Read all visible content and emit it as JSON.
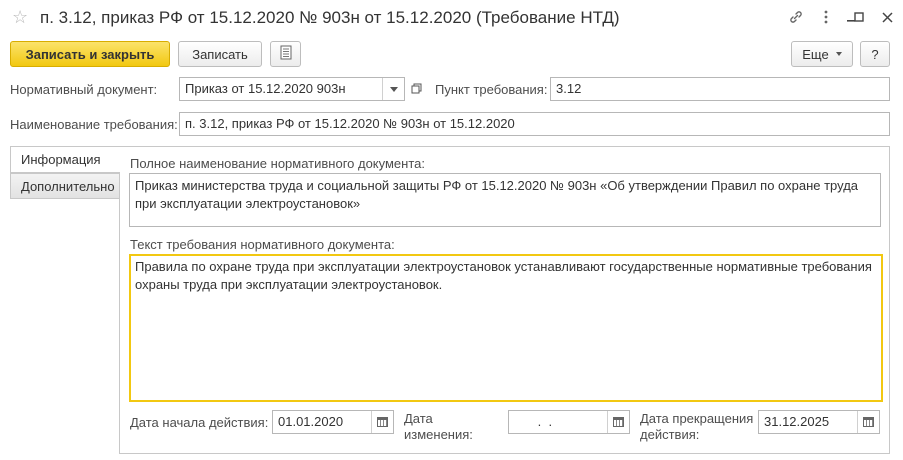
{
  "window": {
    "title": "п. 3.12, приказ РФ от 15.12.2020 № 903н от 15.12.2020 (Требование НТД)"
  },
  "toolbar": {
    "save_close_label": "Записать и закрыть",
    "save_label": "Записать",
    "more_label": "Еще",
    "help_label": "?"
  },
  "form": {
    "normative_doc_label": "Нормативный документ:",
    "normative_doc_value": "Приказ от 15.12.2020 903н",
    "clause_label": "Пункт требования:",
    "clause_value": "3.12",
    "requirement_name_label": "Наименование требования:",
    "requirement_name_value": "п. 3.12, приказ РФ от 15.12.2020 № 903н от 15.12.2020"
  },
  "tabs": [
    {
      "label": "Информация",
      "active": true
    },
    {
      "label": "Дополнительно",
      "active": false
    }
  ],
  "info": {
    "full_name_label": "Полное наименование нормативного документа:",
    "full_name_value": "Приказ министерства труда и социальной защиты РФ от 15.12.2020 № 903н «Об утверждении Правил по охране труда при эксплуатации электроустановок»",
    "requirement_text_label": "Текст требования нормативного документа:",
    "requirement_text_value": "Правила по охране труда при эксплуатации электроустановок устанавливают государственные нормативные требования охраны труда при эксплуатации электроустановок.",
    "start_date_label": "Дата начала действия:",
    "start_date_value": "01.01.2020",
    "change_date_label_1": "Дата",
    "change_date_label_2": "изменения:",
    "change_date_value": " .  .",
    "end_date_label_1": "Дата прекращения",
    "end_date_label_2": "действия:",
    "end_date_value": "31.12.2025"
  },
  "colors": {
    "primary_button": "#f2c811",
    "focus_border": "#f2c811"
  },
  "icons": [
    "star-icon",
    "link-icon",
    "more-vert-icon",
    "minimize-icon",
    "maximize-icon",
    "close-icon",
    "report-icon",
    "dropdown-icon",
    "open-icon",
    "calendar-icon"
  ]
}
